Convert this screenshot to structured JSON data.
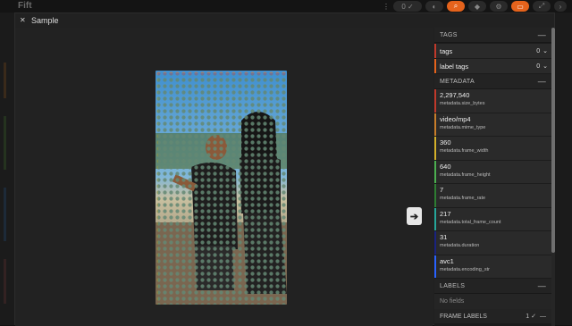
{
  "background": {
    "title": "Fift",
    "controls": [
      {
        "icon": "dots-icon",
        "label": "⋮"
      },
      {
        "icon": "status-pill",
        "label": "0 ✓"
      },
      {
        "icon": "palette-icon",
        "label": "◐"
      },
      {
        "icon": "search-icon",
        "label": "⌕"
      },
      {
        "icon": "tag-icon",
        "label": "◆"
      },
      {
        "icon": "gear-icon",
        "label": "⚙"
      },
      {
        "icon": "layout-icon",
        "label": "▭"
      },
      {
        "icon": "expand-icon",
        "label": "⤢"
      },
      {
        "icon": "chevron-right-icon",
        "label": "›"
      }
    ]
  },
  "modal": {
    "title": "Sample",
    "title_icon": "close-icon"
  },
  "viewer": {
    "next_icon": "next-arrow-icon",
    "next_glyph": "➔"
  },
  "sidebar": {
    "tags_section": {
      "label": "TAGS",
      "collapse": "—",
      "rows": [
        {
          "label": "tags",
          "count": "0",
          "color": "#c0392b"
        },
        {
          "label": "label tags",
          "count": "0",
          "color": "#e5631c"
        }
      ]
    },
    "metadata_section": {
      "label": "METADATA",
      "collapse": "—",
      "rows": [
        {
          "value": "2,297,540",
          "key": "metadata.size_bytes",
          "color": "#c0392b"
        },
        {
          "value": "video/mp4",
          "key": "metadata.mime_type",
          "color": "#c77d2a"
        },
        {
          "value": "360",
          "key": "metadata.frame_width",
          "color": "#d4b02a"
        },
        {
          "value": "640",
          "key": "metadata.frame_height",
          "color": "#4caf50"
        },
        {
          "value": "7",
          "key": "metadata.frame_rate",
          "color": "#2e7d32"
        },
        {
          "value": "217",
          "key": "metadata.total_frame_count",
          "color": "#26a69a"
        },
        {
          "value": "31",
          "key": "metadata.duration",
          "color": "#1a237e"
        },
        {
          "value": "avc1",
          "key": "metadata.encoding_str",
          "color": "#2962ff"
        }
      ]
    },
    "labels_section": {
      "label": "LABELS",
      "collapse": "—",
      "empty": "No fields"
    },
    "frame_labels_section": {
      "label": "FRAME LABELS",
      "count": "1 ✓",
      "collapse": "—"
    }
  },
  "colors": {
    "accent": "#e5631c",
    "panel": "#212121",
    "row": "#2a2a2a"
  }
}
